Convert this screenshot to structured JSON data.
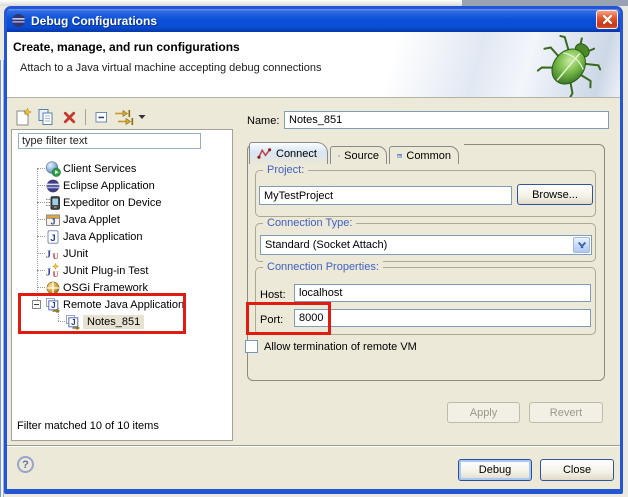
{
  "window": {
    "title": "Debug Configurations"
  },
  "header": {
    "title": "Create, manage, and run configurations",
    "subtitle": "Attach to a Java virtual machine accepting debug connections"
  },
  "sidebar": {
    "filter_value": "type filter text",
    "tree": [
      {
        "label": "Client Services",
        "icon": "client-services-icon"
      },
      {
        "label": "Eclipse Application",
        "icon": "eclipse-application-icon"
      },
      {
        "label": "Expeditor on Device",
        "icon": "expeditor-device-icon"
      },
      {
        "label": "Java Applet",
        "icon": "java-applet-icon"
      },
      {
        "label": "Java Application",
        "icon": "java-application-icon"
      },
      {
        "label": "JUnit",
        "icon": "junit-icon"
      },
      {
        "label": "JUnit Plug-in Test",
        "icon": "junit-plugin-icon"
      },
      {
        "label": "OSGi Framework",
        "icon": "osgi-framework-icon"
      },
      {
        "label": "Remote Java Application",
        "icon": "remote-java-icon",
        "expanded": true
      },
      {
        "label": "Notes_851",
        "icon": "remote-java-icon",
        "selected": true,
        "child": true
      }
    ],
    "status": "Filter matched 10 of 10 items"
  },
  "main": {
    "name_label": "Name:",
    "name_value": "Notes_851",
    "tabs": [
      {
        "label": "Connect",
        "selected": true
      },
      {
        "label": "Source",
        "selected": false
      },
      {
        "label": "Common",
        "selected": false
      }
    ],
    "project": {
      "label": "Project:",
      "value": "MyTestProject",
      "browse_label": "Browse..."
    },
    "connection_type": {
      "label": "Connection Type:",
      "value": "Standard (Socket Attach)"
    },
    "connection_properties": {
      "label": "Connection Properties:",
      "host_label": "Host:",
      "host_value": "localhost",
      "port_label": "Port:",
      "port_value": "8000"
    },
    "terminate_checkbox": {
      "label": "Allow termination of remote VM",
      "checked": false
    },
    "apply_label": "Apply",
    "revert_label": "Revert"
  },
  "footer": {
    "help_glyph": "?",
    "debug_label": "Debug",
    "close_label": "Close"
  },
  "annotations": {
    "highlight_color": "#e01b10",
    "items": [
      "remote-java-application-node",
      "port-field"
    ]
  },
  "colors": {
    "titlebar_blue": "#0a50d8",
    "dialog_bg": "#ece9d8",
    "group_label_blue": "#4161c2"
  }
}
